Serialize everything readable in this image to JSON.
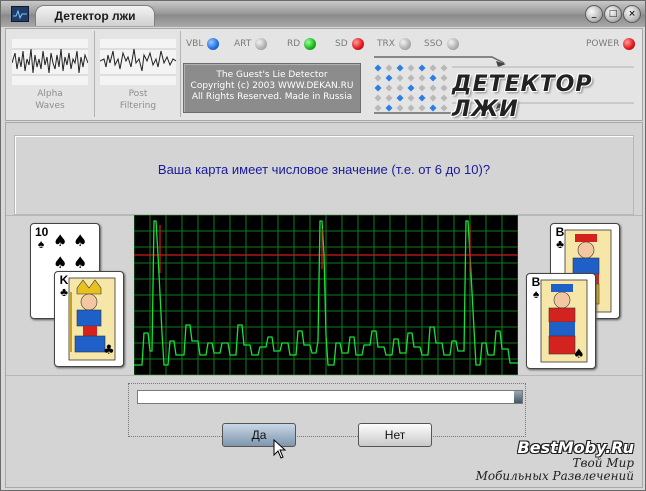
{
  "window": {
    "title": "Детектор лжи",
    "buttons": [
      "_",
      "□",
      "×"
    ]
  },
  "waves": [
    {
      "label_line1": "Alpha",
      "label_line2": "Waves"
    },
    {
      "label_line1": "Post",
      "label_line2": "Filtering"
    }
  ],
  "indicators": [
    {
      "label": "VBL",
      "color": "blue"
    },
    {
      "label": "ART",
      "color": "gray"
    },
    {
      "label": "RD",
      "color": "green"
    },
    {
      "label": "SD",
      "color": "red"
    },
    {
      "label": "TRX",
      "color": "gray"
    },
    {
      "label": "SSO",
      "color": "gray"
    },
    {
      "label": "POWER",
      "color": "red"
    }
  ],
  "copyright": {
    "line1": "The Guest's Lie Detector",
    "line2": "Copyright (c) 2003 WWW.DEKAN.RU",
    "line3": "All Rights Reserved. Made in Russia"
  },
  "logo": {
    "text": "ДЕТЕКТОР ЛЖИ"
  },
  "question": "Ваша карта имеет числовое значение (т.е. от 6 до 10)?",
  "cards_left": [
    {
      "rank": "10",
      "suit": "♠"
    },
    {
      "rank": "K",
      "suit": "♣"
    }
  ],
  "cards_right": [
    {
      "rank": "B",
      "suit": "♣"
    },
    {
      "rank": "B",
      "suit": "♠"
    }
  ],
  "progress": {
    "value": 1.0
  },
  "buttons": {
    "yes": "Да",
    "no": "Нет"
  },
  "watermark": {
    "line1": "BestMoby.Ru",
    "line2": "Твой Мир",
    "line3": "Мобильных Развлечений"
  },
  "colors": {
    "question_text": "#1a1a9a",
    "ecg_grid": "#0f7a1a",
    "ecg_trace": "#19e03a",
    "ecg_baseline": "#c81c1c"
  }
}
